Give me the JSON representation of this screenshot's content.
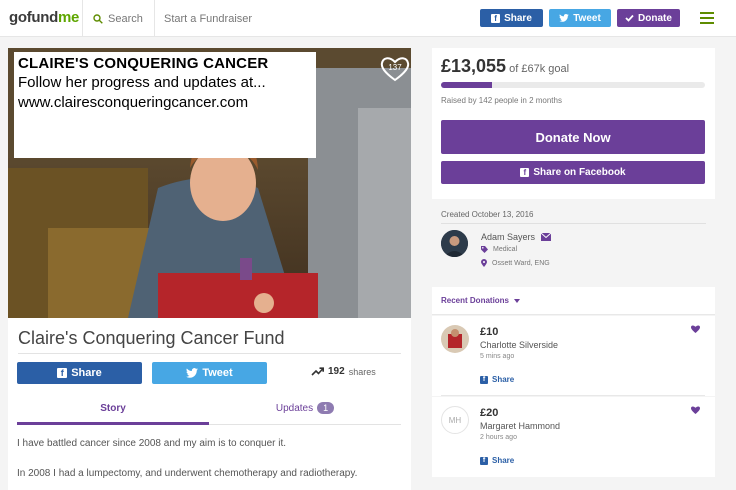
{
  "nav": {
    "logo_go": "gofund",
    "logo_me": "me",
    "search": "Search",
    "start": "Start a Fundraiser",
    "share_btn": "Share",
    "tweet_btn": "Tweet",
    "donate_btn": "Donate"
  },
  "photo": {
    "line1": "CLAIRE'S CONQUERING CANCER",
    "line2": "Follow her progress and updates at...",
    "line3": "www.clairesconqueringcancer.com",
    "heart_count": "137"
  },
  "campaign": {
    "title": "Claire's Conquering Cancer Fund",
    "share_btn": "Share",
    "tweet_btn": "Tweet",
    "shares_count": "192",
    "shares_label": "shares",
    "tab_story": "Story",
    "tab_updates": "Updates",
    "updates_count": "1",
    "story_p1": "I have battled cancer since 2008 and my aim is to conquer it.",
    "story_p2": "In 2008 I had a lumpectomy, and underwent chemotherapy and radiotherapy."
  },
  "donate": {
    "raised": "£13,055",
    "goal": "of £67k goal",
    "progress_fraction": 0.195,
    "raised_by": "Raised by 142 people in 2 months",
    "donate_now": "Donate Now",
    "share_facebook": "Share on Facebook"
  },
  "organizer": {
    "created": "Created October 13, 2016",
    "name": "Adam Sayers",
    "category": "Medical",
    "location": "Ossett Ward, ENG"
  },
  "recent": {
    "header": "Recent Donations",
    "items": [
      {
        "amount": "£10",
        "name": "Charlotte Silverside",
        "time": "5 mins ago",
        "share": "Share",
        "initials": ""
      },
      {
        "amount": "£20",
        "name": "Margaret Hammond",
        "time": "2 hours ago",
        "share": "Share",
        "initials": "MH"
      }
    ]
  },
  "colors": {
    "brand_purple": "#6b3f99",
    "facebook_blue": "#2b5fa6",
    "twitter_blue": "#47a7e4",
    "logo_green": "#5ea600"
  }
}
